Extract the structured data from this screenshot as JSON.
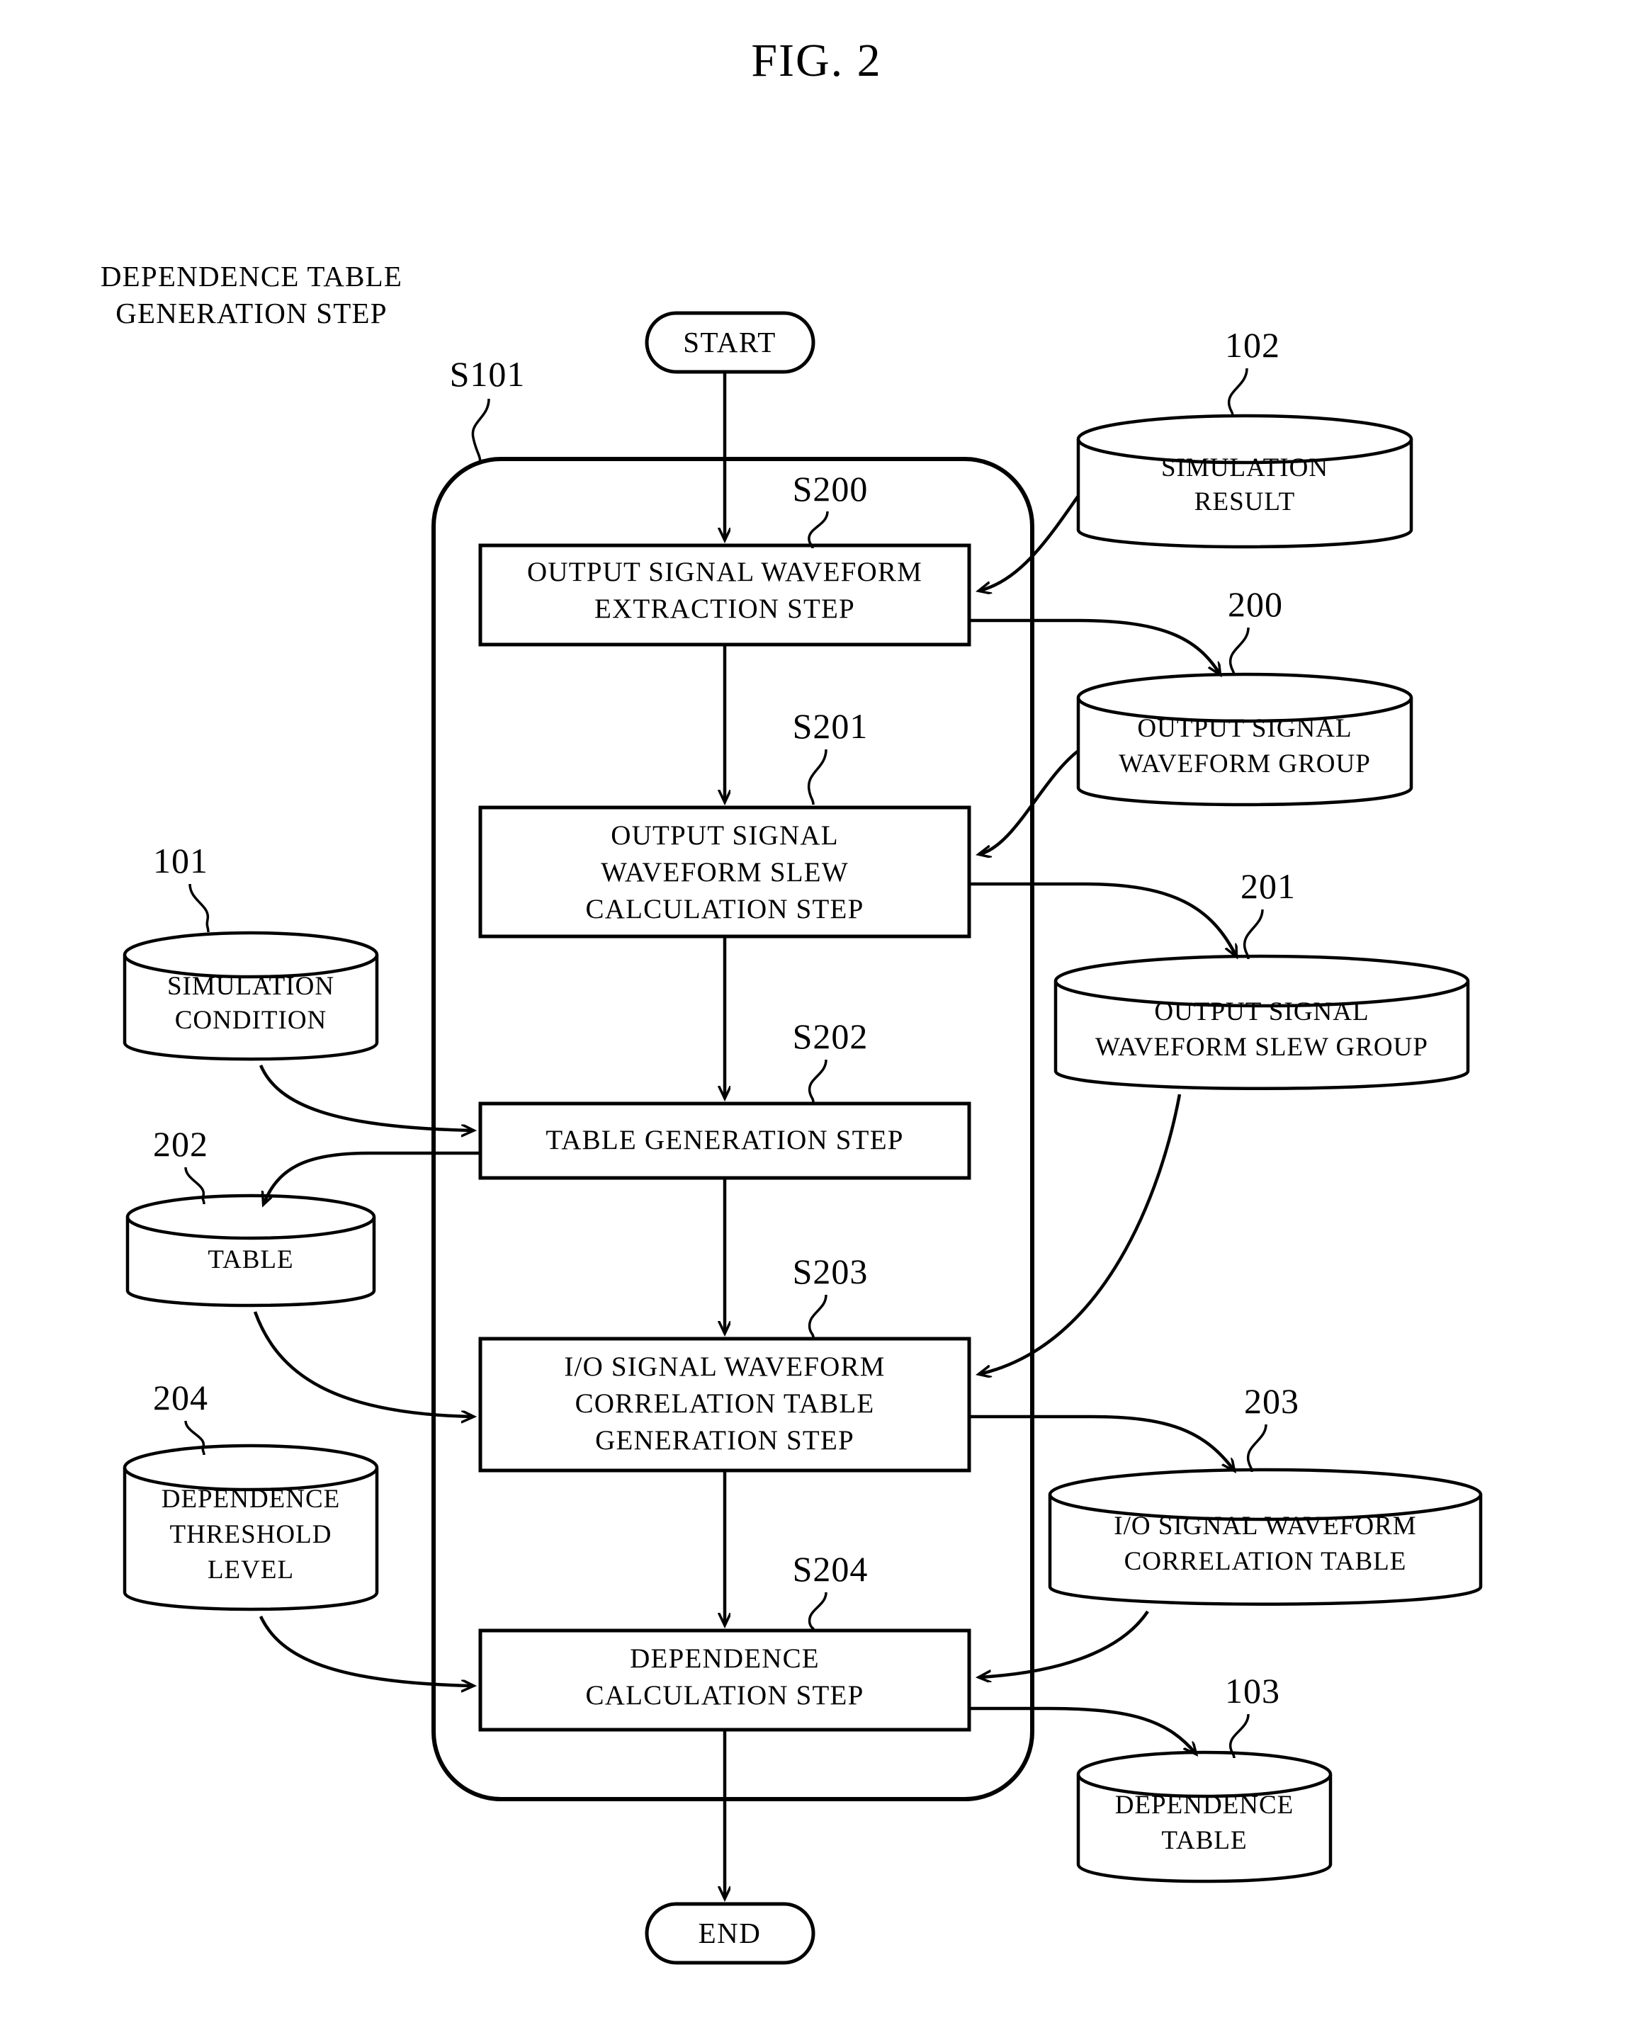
{
  "figure": {
    "title": "FIG. 2",
    "caption_lines": [
      "DEPENDENCE TABLE",
      "GENERATION STEP"
    ],
    "container_ref": "S101"
  },
  "terminals": {
    "start": "START",
    "end": "END"
  },
  "steps": [
    {
      "ref": "S200",
      "lines": [
        "OUTPUT SIGNAL WAVEFORM",
        "EXTRACTION STEP"
      ]
    },
    {
      "ref": "S201",
      "lines": [
        "OUTPUT SIGNAL",
        "WAVEFORM SLEW",
        "CALCULATION STEP"
      ]
    },
    {
      "ref": "S202",
      "lines": [
        "TABLE GENERATION STEP"
      ]
    },
    {
      "ref": "S203",
      "lines": [
        "I/O SIGNAL WAVEFORM",
        "CORRELATION TABLE",
        "GENERATION STEP"
      ]
    },
    {
      "ref": "S204",
      "lines": [
        "DEPENDENCE",
        "CALCULATION STEP"
      ]
    }
  ],
  "datastores": [
    {
      "ref": "102",
      "lines": [
        "SIMULATION",
        "RESULT"
      ],
      "side": "right"
    },
    {
      "ref": "200",
      "lines": [
        "OUTPUT SIGNAL",
        "WAVEFORM GROUP"
      ],
      "side": "right"
    },
    {
      "ref": "201",
      "lines": [
        "OUTPUT SIGNAL",
        "WAVEFORM SLEW GROUP"
      ],
      "side": "right"
    },
    {
      "ref": "203",
      "lines": [
        "I/O SIGNAL WAVEFORM",
        "CORRELATION TABLE"
      ],
      "side": "right"
    },
    {
      "ref": "103",
      "lines": [
        "DEPENDENCE",
        "TABLE"
      ],
      "side": "right"
    },
    {
      "ref": "101",
      "lines": [
        "SIMULATION",
        "CONDITION"
      ],
      "side": "left"
    },
    {
      "ref": "202",
      "lines": [
        "TABLE"
      ],
      "side": "left"
    },
    {
      "ref": "204",
      "lines": [
        "DEPENDENCE",
        "THRESHOLD",
        "LEVEL"
      ],
      "side": "left"
    }
  ],
  "colors": {
    "ink": "#000000",
    "paper": "#ffffff"
  }
}
